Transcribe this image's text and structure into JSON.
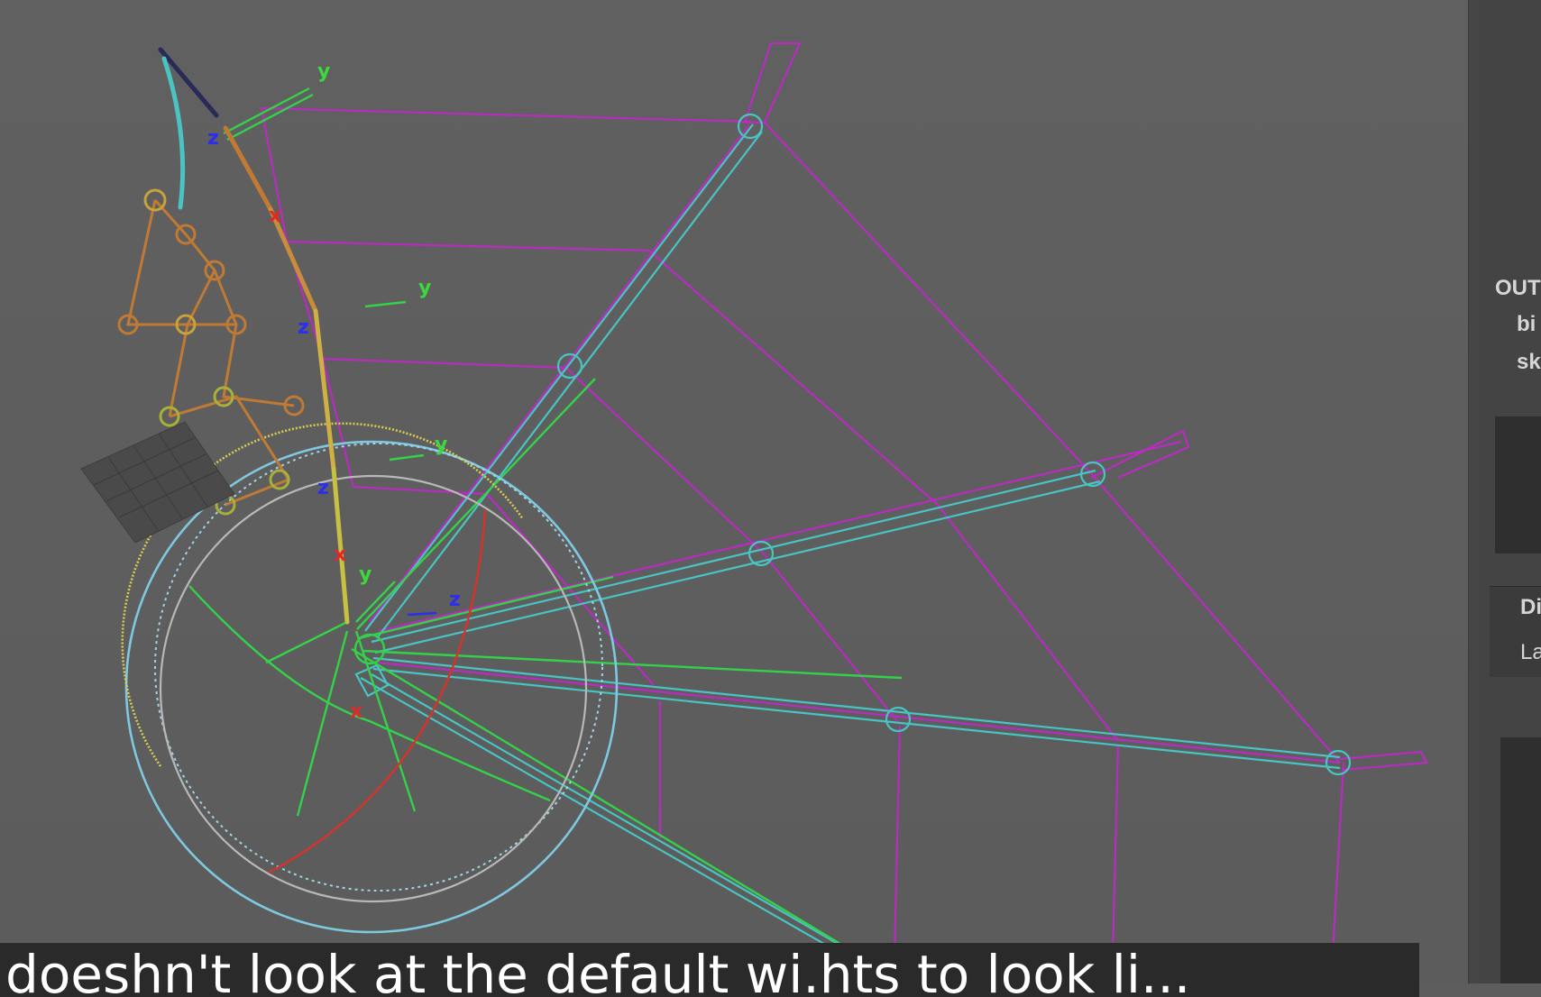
{
  "viewport": {
    "axis_labels": {
      "y": "y",
      "z": "z",
      "x": "x"
    },
    "colors": {
      "background": "#5d5d5d",
      "mesh_wire": "#b82cc0",
      "joint_wire": "#49c4c2",
      "ik_handle": "#34d24a",
      "control_circle": "#7fc9e0",
      "rig_orange": "#c07a34",
      "red_arc": "#d8322a",
      "yellow_ring": "#d9cc52"
    }
  },
  "side_panel": {
    "labels": [
      "OUT",
      "bi",
      "sk",
      "Di",
      "La"
    ]
  },
  "subtitle": {
    "text": "doeshn't look at the default wi.hts to look li..."
  }
}
